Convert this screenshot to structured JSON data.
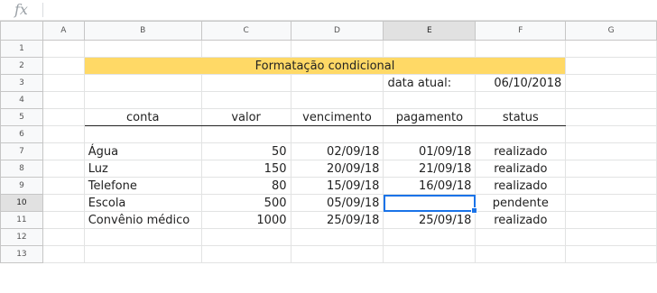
{
  "formula_bar": {
    "fx_label": "fx",
    "value": ""
  },
  "columns": [
    "A",
    "B",
    "C",
    "D",
    "E",
    "F",
    "G"
  ],
  "rows": [
    "1",
    "2",
    "3",
    "4",
    "5",
    "6",
    "7",
    "8",
    "9",
    "10",
    "11",
    "12",
    "13"
  ],
  "title": "Formatação condicional",
  "date_label": "data atual:",
  "date_value": "06/10/2018",
  "headers": {
    "conta": "conta",
    "valor": "valor",
    "vencimento": "vencimento",
    "pagamento": "pagamento",
    "status": "status"
  },
  "records": [
    {
      "conta": "Água",
      "valor": "50",
      "vencimento": "02/09/18",
      "pagamento": "01/09/18",
      "status": "realizado"
    },
    {
      "conta": "Luz",
      "valor": "150",
      "vencimento": "20/09/18",
      "pagamento": "21/09/18",
      "status": "realizado"
    },
    {
      "conta": "Telefone",
      "valor": "80",
      "vencimento": "15/09/18",
      "pagamento": "16/09/18",
      "status": "realizado"
    },
    {
      "conta": "Escola",
      "valor": "500",
      "vencimento": "05/09/18",
      "pagamento": "",
      "status": "pendente"
    },
    {
      "conta": "Convênio médico",
      "valor": "1000",
      "vencimento": "25/09/18",
      "pagamento": "25/09/18",
      "status": "realizado"
    }
  ],
  "colors": {
    "title_bg": "#ffd966",
    "title_text": "#3c5ec9",
    "status_done": "#2a37d6",
    "status_pending": "#e00000",
    "selection": "#1a73e8"
  },
  "selected_cell": "E10"
}
